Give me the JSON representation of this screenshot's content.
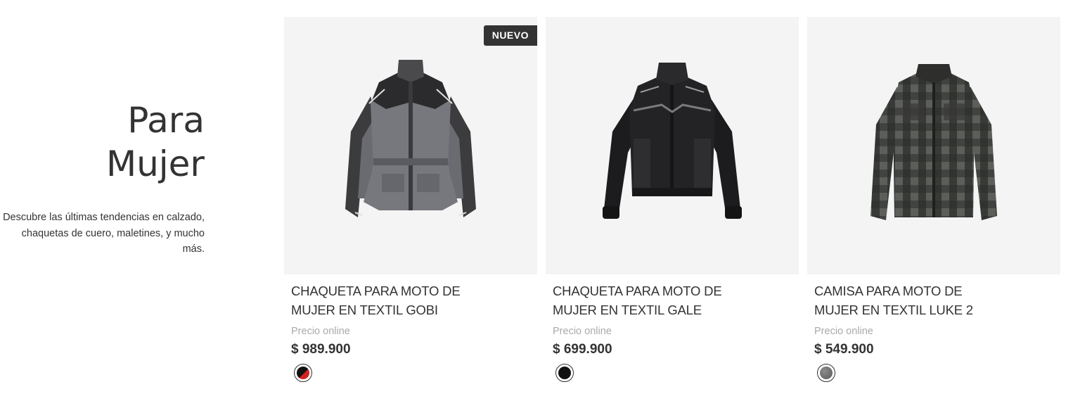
{
  "intro": {
    "title_line1": "Para",
    "title_line2": "Mujer",
    "description": "Descubre las últimas tendencias en calzado, chaquetas de cuero, maletines, y mucho más."
  },
  "products": [
    {
      "badge": "NUEVO",
      "name": "CHAQUETA PARA MOTO DE MUJER EN TEXTIL GOBI",
      "price_label": "Precio online",
      "price": "$ 989.900",
      "image": "gray-black-textile-jacket",
      "swatch": "black-red"
    },
    {
      "name": "CHAQUETA PARA MOTO DE MUJER EN TEXTIL GALE",
      "price_label": "Precio online",
      "price": "$ 699.900",
      "image": "black-textile-jacket",
      "swatch": "black"
    },
    {
      "name": "CAMISA PARA MOTO DE MUJER EN TEXTIL LUKE 2",
      "price_label": "Precio online",
      "price": "$ 549.900",
      "image": "gray-plaid-shirt",
      "swatch": "gray"
    }
  ],
  "colors": {
    "swatch_black": "#111111",
    "swatch_red": "#d32020",
    "swatch_gray": "#6e6e6e",
    "badge_bg": "#333333",
    "image_bg": "#f4f4f4"
  }
}
